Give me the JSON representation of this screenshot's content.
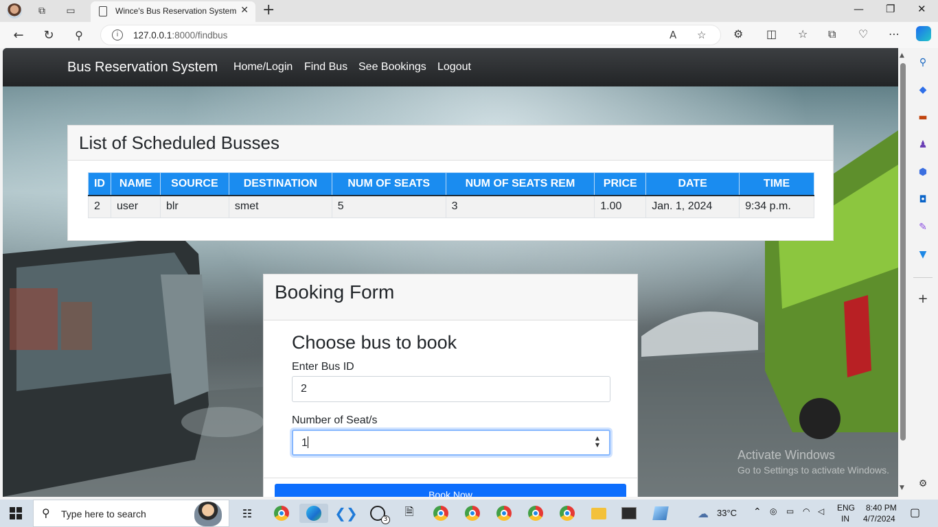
{
  "browser": {
    "tab_title": "Wince's Bus Reservation System",
    "url_host": "127.0.0.1",
    "url_rest": ":8000/findbus"
  },
  "navbar": {
    "brand": "Bus Reservation System",
    "links": [
      "Home/Login",
      "Find Bus",
      "See Bookings",
      "Logout"
    ]
  },
  "bus_list": {
    "title": "List of Scheduled Busses",
    "columns": [
      "ID",
      "NAME",
      "SOURCE",
      "DESTINATION",
      "NUM OF SEATS",
      "NUM OF SEATS REM",
      "PRICE",
      "DATE",
      "TIME"
    ],
    "rows": [
      [
        "2",
        "user",
        "blr",
        "smet",
        "5",
        "3",
        "1.00",
        "Jan. 1, 2024",
        "9:34 p.m."
      ]
    ]
  },
  "booking_form": {
    "title": "Booking Form",
    "subtitle": "Choose bus to book",
    "bus_id_label": "Enter Bus ID",
    "bus_id_value": "2",
    "seats_label": "Number of Seat/s",
    "seats_value": "1",
    "submit_label": "Book Now"
  },
  "watermark": {
    "line1": "Activate Windows",
    "line2": "Go to Settings to activate Windows."
  },
  "taskbar": {
    "search_placeholder": "Type here to search",
    "whatsapp_badge": "3",
    "temperature": "33°C",
    "language": "ENG",
    "region": "IN",
    "time": "8:40 PM",
    "date": "4/7/2024"
  },
  "colors": {
    "table_header": "#1a8cf0",
    "primary_button": "#0d6efd",
    "navbar": "#2b2d2f"
  }
}
